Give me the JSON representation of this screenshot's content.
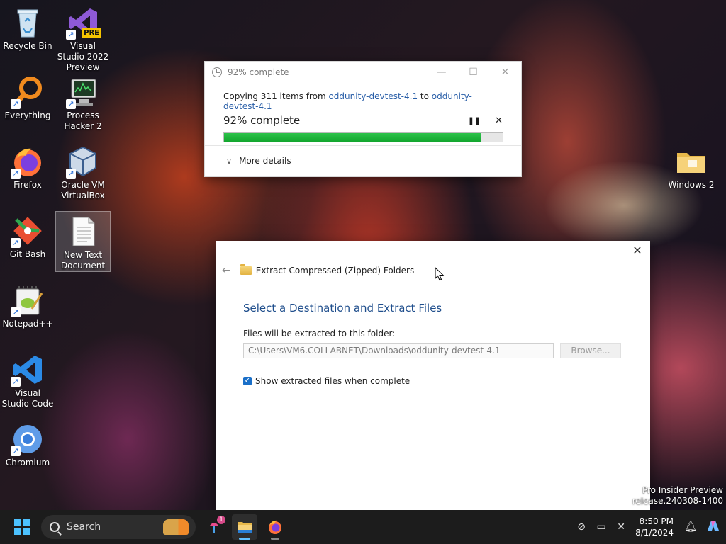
{
  "desktop": {
    "icons": [
      {
        "label": "Recycle Bin"
      },
      {
        "label": "Visual Studio 2022 Preview",
        "badge": "PRE"
      },
      {
        "label": "Everything"
      },
      {
        "label": "Process Hacker 2"
      },
      {
        "label": "Firefox"
      },
      {
        "label": "Oracle VM VirtualBox"
      },
      {
        "label": "Git Bash"
      },
      {
        "label": "New Text Document"
      },
      {
        "label": "Notepad++"
      },
      {
        "label": "Visual Studio Code"
      },
      {
        "label": "Chromium"
      },
      {
        "label": "Windows 2"
      }
    ],
    "watermark_line1": "Pro Insider Preview",
    "watermark_line2": "release.240308-1400"
  },
  "copy_dialog": {
    "title": "92% complete",
    "copying_prefix": "Copying 311 items from",
    "source": "oddunity-devtest-4.1",
    "to_word": "to",
    "destination": "oddunity-devtest-4.1",
    "status": "92% complete",
    "progress_percent": 92,
    "pause_glyph": "❚❚",
    "cancel_glyph": "✕",
    "more_details": "More details",
    "minimize_glyph": "—",
    "maximize_glyph": "☐",
    "close_glyph": "✕"
  },
  "extract_dialog": {
    "window_title": "Extract Compressed (Zipped) Folders",
    "heading": "Select a Destination and Extract Files",
    "folder_label": "Files will be extracted to this folder:",
    "folder_path": "C:\\Users\\VM6.COLLABNET\\Downloads\\oddunity-devtest-4.1",
    "browse_label": "Browse...",
    "show_files_label": "Show extracted files when complete",
    "show_files_checked": true,
    "close_glyph": "✕",
    "back_glyph": "←"
  },
  "taskbar": {
    "search_label": "Search",
    "notification_count": "1",
    "time": "8:50 PM",
    "date": "8/1/2024"
  },
  "colors": {
    "accent": "#1a6fc8",
    "progress": "#13a62e",
    "link": "#2a5fa8",
    "heading": "#1f4e8c"
  }
}
